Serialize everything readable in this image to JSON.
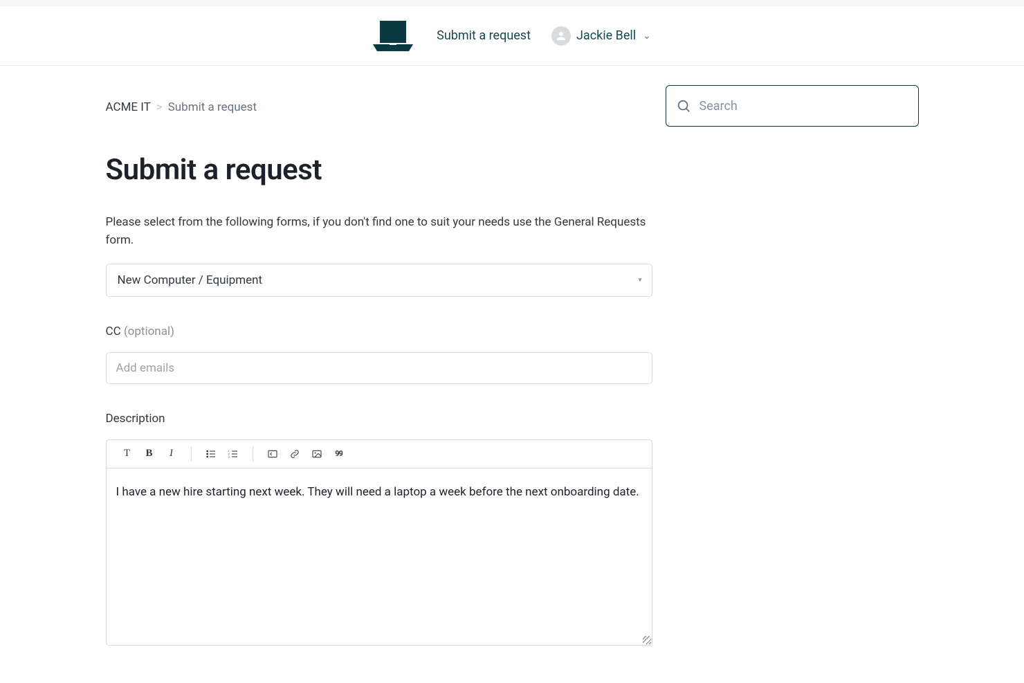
{
  "header": {
    "nav_submit_label": "Submit a request",
    "user_name": "Jackie Bell"
  },
  "breadcrumb": {
    "root": "ACME IT",
    "current": "Submit a request"
  },
  "page": {
    "title": "Submit a request",
    "instruction": "Please select from the following forms, if you don't find one to suit your needs use the General Requests form."
  },
  "form_select": {
    "selected": "New Computer / Equipment"
  },
  "cc": {
    "label": "CC",
    "optional_label": "(optional)",
    "placeholder": "Add emails",
    "value": ""
  },
  "description": {
    "label": "Description",
    "value": "I have a new hire starting next week. They will need a laptop a week before the next onboarding date."
  },
  "toolbar": {
    "paragraph": "T",
    "bold": "B",
    "italic": "I",
    "quote": "❝"
  },
  "search": {
    "placeholder": "Search",
    "value": ""
  }
}
